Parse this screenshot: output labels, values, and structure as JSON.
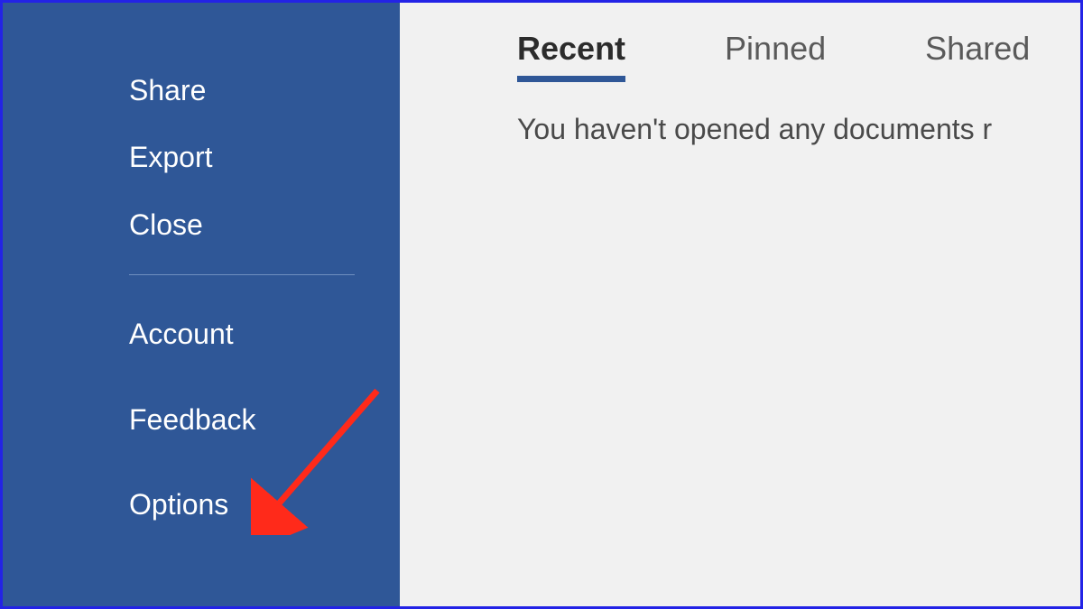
{
  "sidebar": {
    "group1": [
      {
        "label": "Share"
      },
      {
        "label": "Export"
      },
      {
        "label": "Close"
      }
    ],
    "group2": [
      {
        "label": "Account"
      },
      {
        "label": "Feedback"
      },
      {
        "label": "Options"
      }
    ]
  },
  "main": {
    "tabs": [
      {
        "label": "Recent",
        "active": true
      },
      {
        "label": "Pinned",
        "active": false
      },
      {
        "label": "Shared",
        "active": false
      }
    ],
    "empty_message": "You haven't opened any documents r"
  }
}
